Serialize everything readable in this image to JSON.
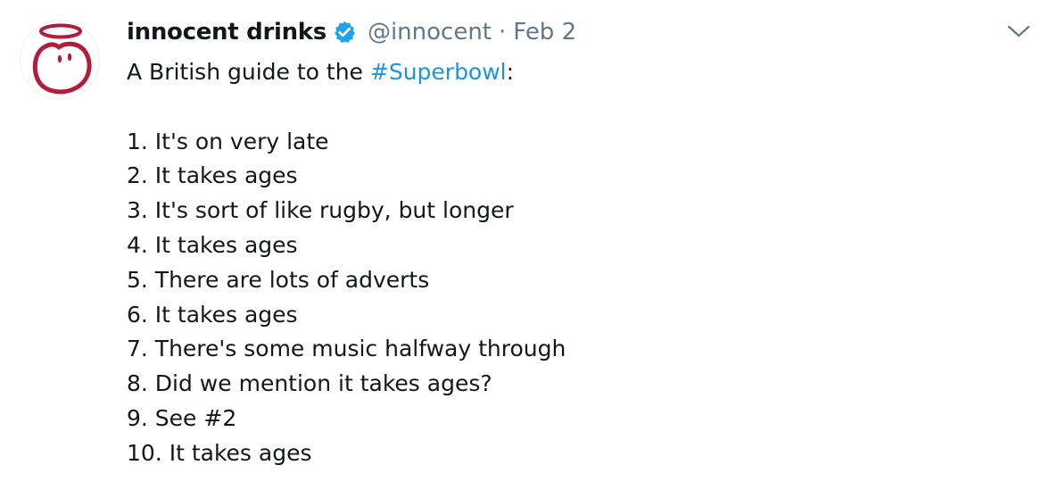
{
  "tweet": {
    "author_name": "innocent drinks",
    "handle": "@innocent",
    "separator": "·",
    "date": "Feb 2",
    "intro_prefix": "A British guide to the ",
    "intro_hashtag": "#Superbowl",
    "intro_suffix": ":",
    "list": [
      "1. It's on very late",
      "2. It takes ages",
      "3. It's sort of like rugby, but longer",
      "4. It takes ages",
      "5. There are lots of adverts",
      "6. It takes ages",
      "7. There's some music halfway through",
      "8. Did we mention it takes ages?",
      "9. See #2",
      "10. It takes ages"
    ]
  },
  "colors": {
    "brand_red": "#b01e3c",
    "verified_blue": "#1da1f2",
    "hashtag_blue": "#1b95e0",
    "secondary_text": "#657786"
  },
  "icons": {
    "avatar": "innocent-logo-icon",
    "verified": "verified-badge-icon",
    "menu": "chevron-down-icon"
  }
}
